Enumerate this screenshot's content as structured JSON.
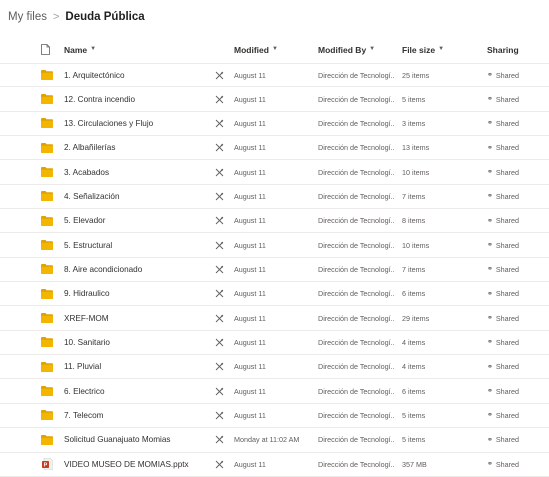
{
  "breadcrumb": {
    "root": "My files",
    "separator": ">",
    "current": "Deuda Pública"
  },
  "columns": {
    "name": "Name",
    "modified": "Modified",
    "modified_by": "Modified By",
    "file_size": "File size",
    "sharing": "Sharing"
  },
  "colors": {
    "folder": "#f2b600",
    "folder_dark": "#e0a200",
    "pptx": "#c43e1c",
    "border": "#edebe9"
  },
  "rows": [
    {
      "type": "folder",
      "name": "1. Arquitectónico",
      "modified": "August 11",
      "modified_by": "Dirección de Tecnologí...",
      "size": "25 items",
      "sharing": "Shared"
    },
    {
      "type": "folder",
      "name": "12. Contra incendio",
      "modified": "August 11",
      "modified_by": "Dirección de Tecnologí...",
      "size": "5 items",
      "sharing": "Shared"
    },
    {
      "type": "folder",
      "name": "13. Circulaciones y Flujo",
      "modified": "August 11",
      "modified_by": "Dirección de Tecnologí...",
      "size": "3 items",
      "sharing": "Shared"
    },
    {
      "type": "folder",
      "name": "2. Albañilerías",
      "modified": "August 11",
      "modified_by": "Dirección de Tecnologí...",
      "size": "13 items",
      "sharing": "Shared"
    },
    {
      "type": "folder",
      "name": "3. Acabados",
      "modified": "August 11",
      "modified_by": "Dirección de Tecnologí...",
      "size": "10 items",
      "sharing": "Shared"
    },
    {
      "type": "folder",
      "name": "4. Señalización",
      "modified": "August 11",
      "modified_by": "Dirección de Tecnologí...",
      "size": "7 items",
      "sharing": "Shared"
    },
    {
      "type": "folder",
      "name": "5. Elevador",
      "modified": "August 11",
      "modified_by": "Dirección de Tecnologí...",
      "size": "8 items",
      "sharing": "Shared"
    },
    {
      "type": "folder",
      "name": "5. Estructural",
      "modified": "August 11",
      "modified_by": "Dirección de Tecnologí...",
      "size": "10 items",
      "sharing": "Shared"
    },
    {
      "type": "folder",
      "name": "8. Aire acondicionado",
      "modified": "August 11",
      "modified_by": "Dirección de Tecnologí...",
      "size": "7 items",
      "sharing": "Shared"
    },
    {
      "type": "folder",
      "name": "9. Hidraulico",
      "modified": "August 11",
      "modified_by": "Dirección de Tecnologí...",
      "size": "6 items",
      "sharing": "Shared"
    },
    {
      "type": "folder",
      "name": "XREF-MOM",
      "modified": "August 11",
      "modified_by": "Dirección de Tecnologí...",
      "size": "29 items",
      "sharing": "Shared"
    },
    {
      "type": "folder",
      "name": "10. Sanitario",
      "modified": "August 11",
      "modified_by": "Dirección de Tecnologí...",
      "size": "4 items",
      "sharing": "Shared"
    },
    {
      "type": "folder",
      "name": "11. Pluvial",
      "modified": "August 11",
      "modified_by": "Dirección de Tecnologí...",
      "size": "4 items",
      "sharing": "Shared"
    },
    {
      "type": "folder",
      "name": "6. Electrico",
      "modified": "August 11",
      "modified_by": "Dirección de Tecnologí...",
      "size": "6 items",
      "sharing": "Shared"
    },
    {
      "type": "folder",
      "name": "7. Telecom",
      "modified": "August 11",
      "modified_by": "Dirección de Tecnologí...",
      "size": "5 items",
      "sharing": "Shared"
    },
    {
      "type": "folder",
      "name": "Solicitud Guanajuato Momias",
      "modified": "Monday at 11:02 AM",
      "modified_by": "Dirección de Tecnologí...",
      "size": "5 items",
      "sharing": "Shared"
    },
    {
      "type": "pptx",
      "name": "VIDEO MUSEO DE MOMIAS.pptx",
      "modified": "August 11",
      "modified_by": "Dirección de Tecnologí...",
      "size": "357 MB",
      "sharing": "Shared"
    }
  ]
}
